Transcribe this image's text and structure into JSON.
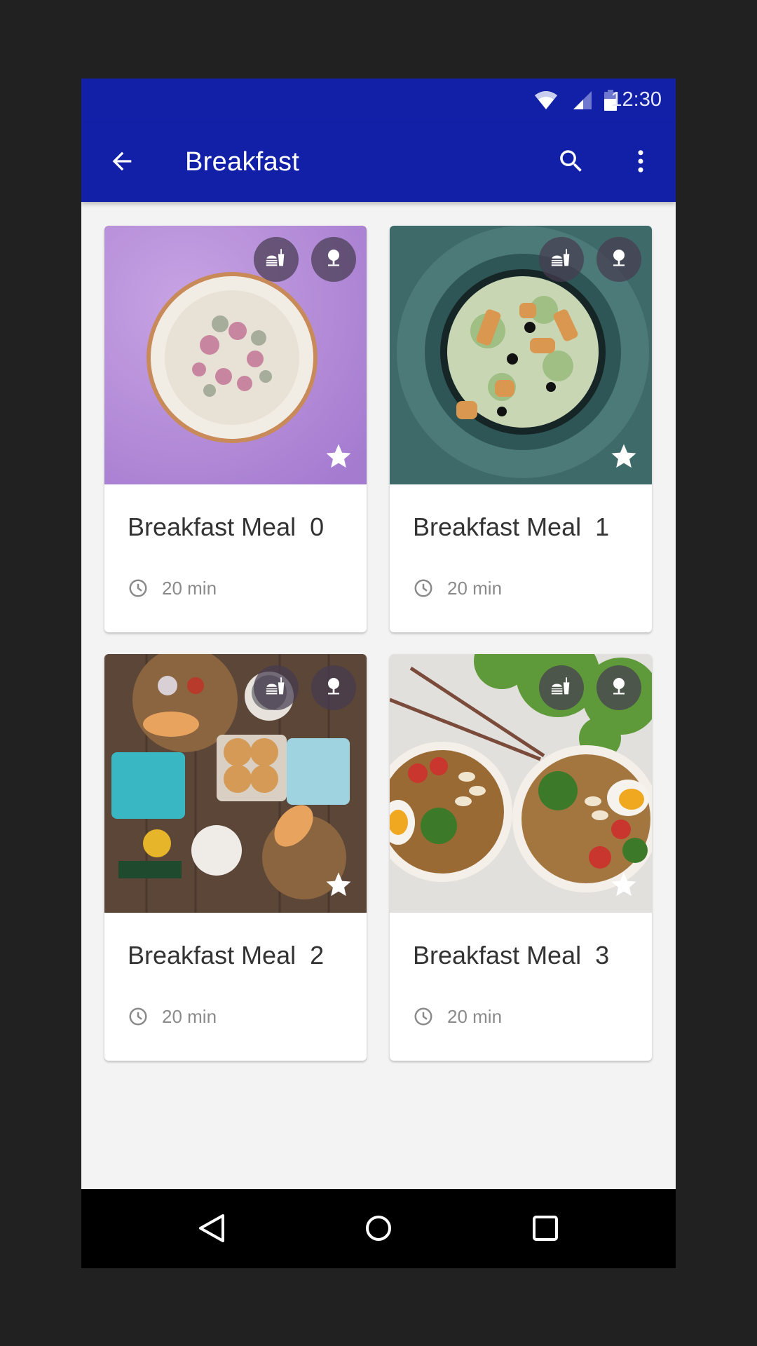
{
  "status_bar": {
    "time": "12:30",
    "icons": [
      "wifi-icon",
      "cellular-signal-icon",
      "battery-icon"
    ]
  },
  "app_bar": {
    "title": "Breakfast",
    "back_icon": "arrow-back-icon",
    "actions": [
      "search-icon",
      "more-vert-icon"
    ]
  },
  "colors": {
    "primary": "#1220a8",
    "background": "#f3f3f3",
    "card_title": "#333333",
    "card_meta": "#8a8a8a"
  },
  "meals": [
    {
      "title": "Breakfast Meal  0",
      "time": "20 min",
      "badges": [
        "fast-food-icon",
        "nature-icon"
      ],
      "favorite": true,
      "image": "bowl of dried rose buds on purple background"
    },
    {
      "title": "Breakfast Meal  1",
      "time": "20 min",
      "badges": [
        "fast-food-icon",
        "nature-icon"
      ],
      "favorite": true,
      "image": "caesar salad in dark bowl on teal"
    },
    {
      "title": "Breakfast Meal  2",
      "time": "20 min",
      "badges": [
        "fast-food-icon",
        "nature-icon"
      ],
      "favorite": true,
      "image": "breakfast spread on wooden table"
    },
    {
      "title": "Breakfast Meal  3",
      "time": "20 min",
      "badges": [
        "fast-food-icon",
        "nature-icon"
      ],
      "favorite": true,
      "image": "two noodle soup bowls with eggs and herbs"
    }
  ],
  "nav_bar": {
    "buttons": [
      "back",
      "home",
      "recents"
    ]
  }
}
